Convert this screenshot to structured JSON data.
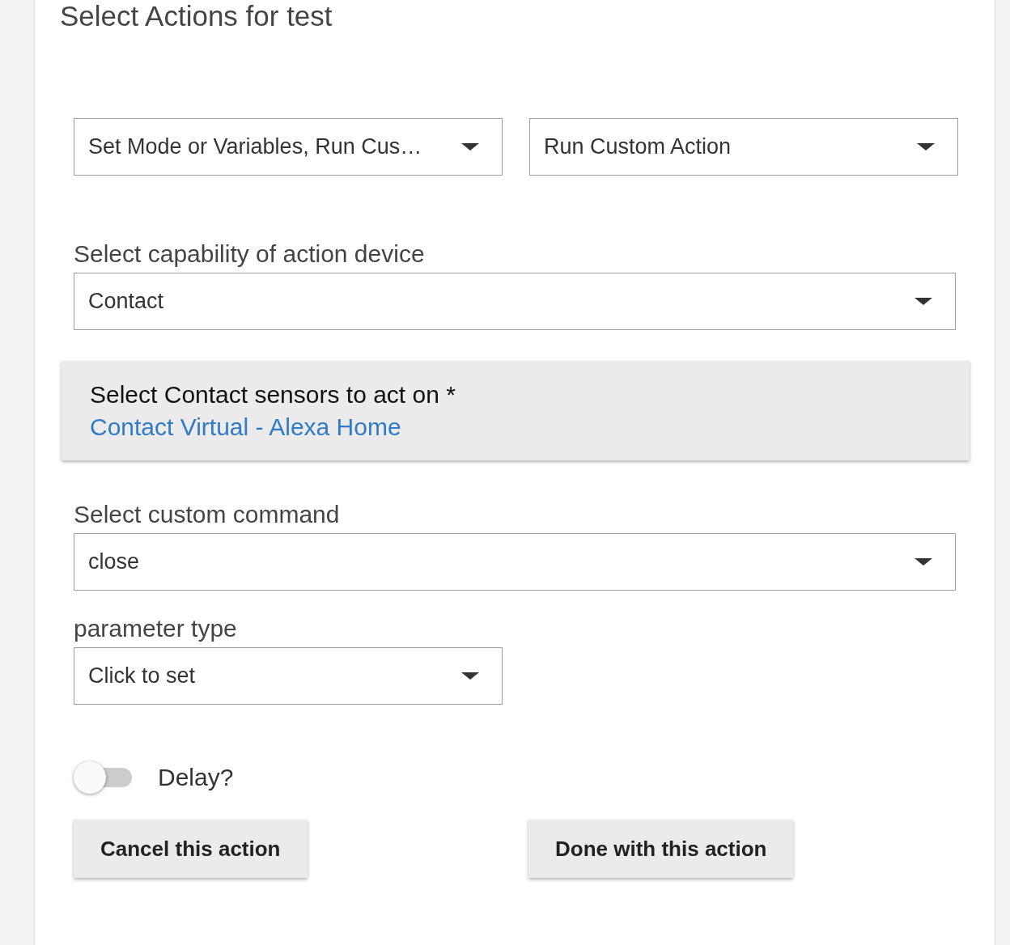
{
  "title": "Select Actions for test",
  "action_selects": [
    {
      "value": "Set Mode or Variables, Run Cus…"
    },
    {
      "value": "Run Custom Action"
    }
  ],
  "capability": {
    "label": "Select capability of action device",
    "value": "Contact"
  },
  "device_panel": {
    "label": "Select Contact sensors to act on *",
    "link": "Contact Virtual - Alexa Home"
  },
  "command": {
    "label": "Select custom command",
    "value": "close"
  },
  "parameter": {
    "label": "parameter type",
    "value": "Click to set"
  },
  "delay": {
    "label": "Delay?",
    "on": false
  },
  "buttons": [
    "Cancel this action",
    "Done with this action"
  ]
}
